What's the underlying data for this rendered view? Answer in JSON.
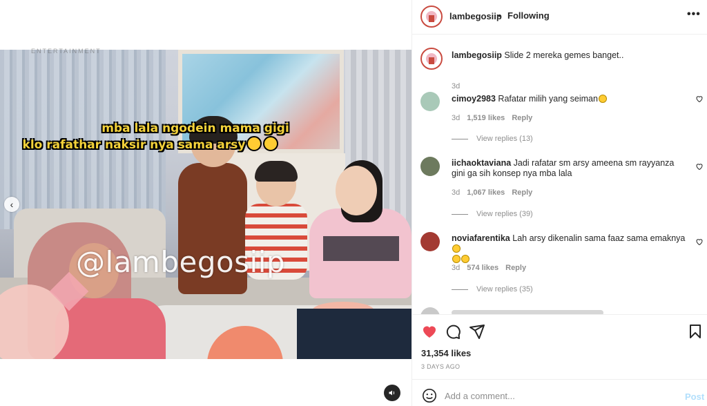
{
  "post": {
    "username": "lambegosiip",
    "separator": "•",
    "follow_status": "Following",
    "more_label": "•••"
  },
  "media": {
    "overlay_line1": "mba lala ngodein mama gigi",
    "overlay_line2": "klo rafathar naksir nya sama arsy",
    "watermark": "@lambegosiip",
    "top_text": "ENTERTAINMENT",
    "prev_label": "‹"
  },
  "caption": {
    "username": "lambegosiip",
    "text": "Slide 2 mereka gemes banget..",
    "time": "3d"
  },
  "comments": [
    {
      "username": "cimoy2983",
      "text": "Rafatar milih yang seiman",
      "emoji_count": 1,
      "time": "3d",
      "likes": "1,519 likes",
      "reply_label": "Reply",
      "view_replies": "View replies (13)",
      "avatar_color": "#a9c9b8"
    },
    {
      "username": "iichaoktaviana",
      "text": "Jadi rafatar sm arsy ameena sm rayyanza gini ga sih konsep nya mba lala",
      "emoji_count": 0,
      "time": "3d",
      "likes": "1,067 likes",
      "reply_label": "Reply",
      "view_replies": "View replies (39)",
      "avatar_color": "#6d7a5e"
    },
    {
      "username": "noviafarentika",
      "text": "Lah arsy dikenalin sama faaz sama emaknya",
      "emoji_count": 3,
      "time": "3d",
      "likes": "574 likes",
      "reply_label": "Reply",
      "view_replies": "View replies (35)",
      "avatar_color": "#a33a32"
    }
  ],
  "actions": {
    "likes": "31,354 likes",
    "time_ago": "3 DAYS AGO",
    "heart_color": "#ed4956"
  },
  "add_comment": {
    "placeholder": "Add a comment...",
    "post_label": "Post"
  }
}
